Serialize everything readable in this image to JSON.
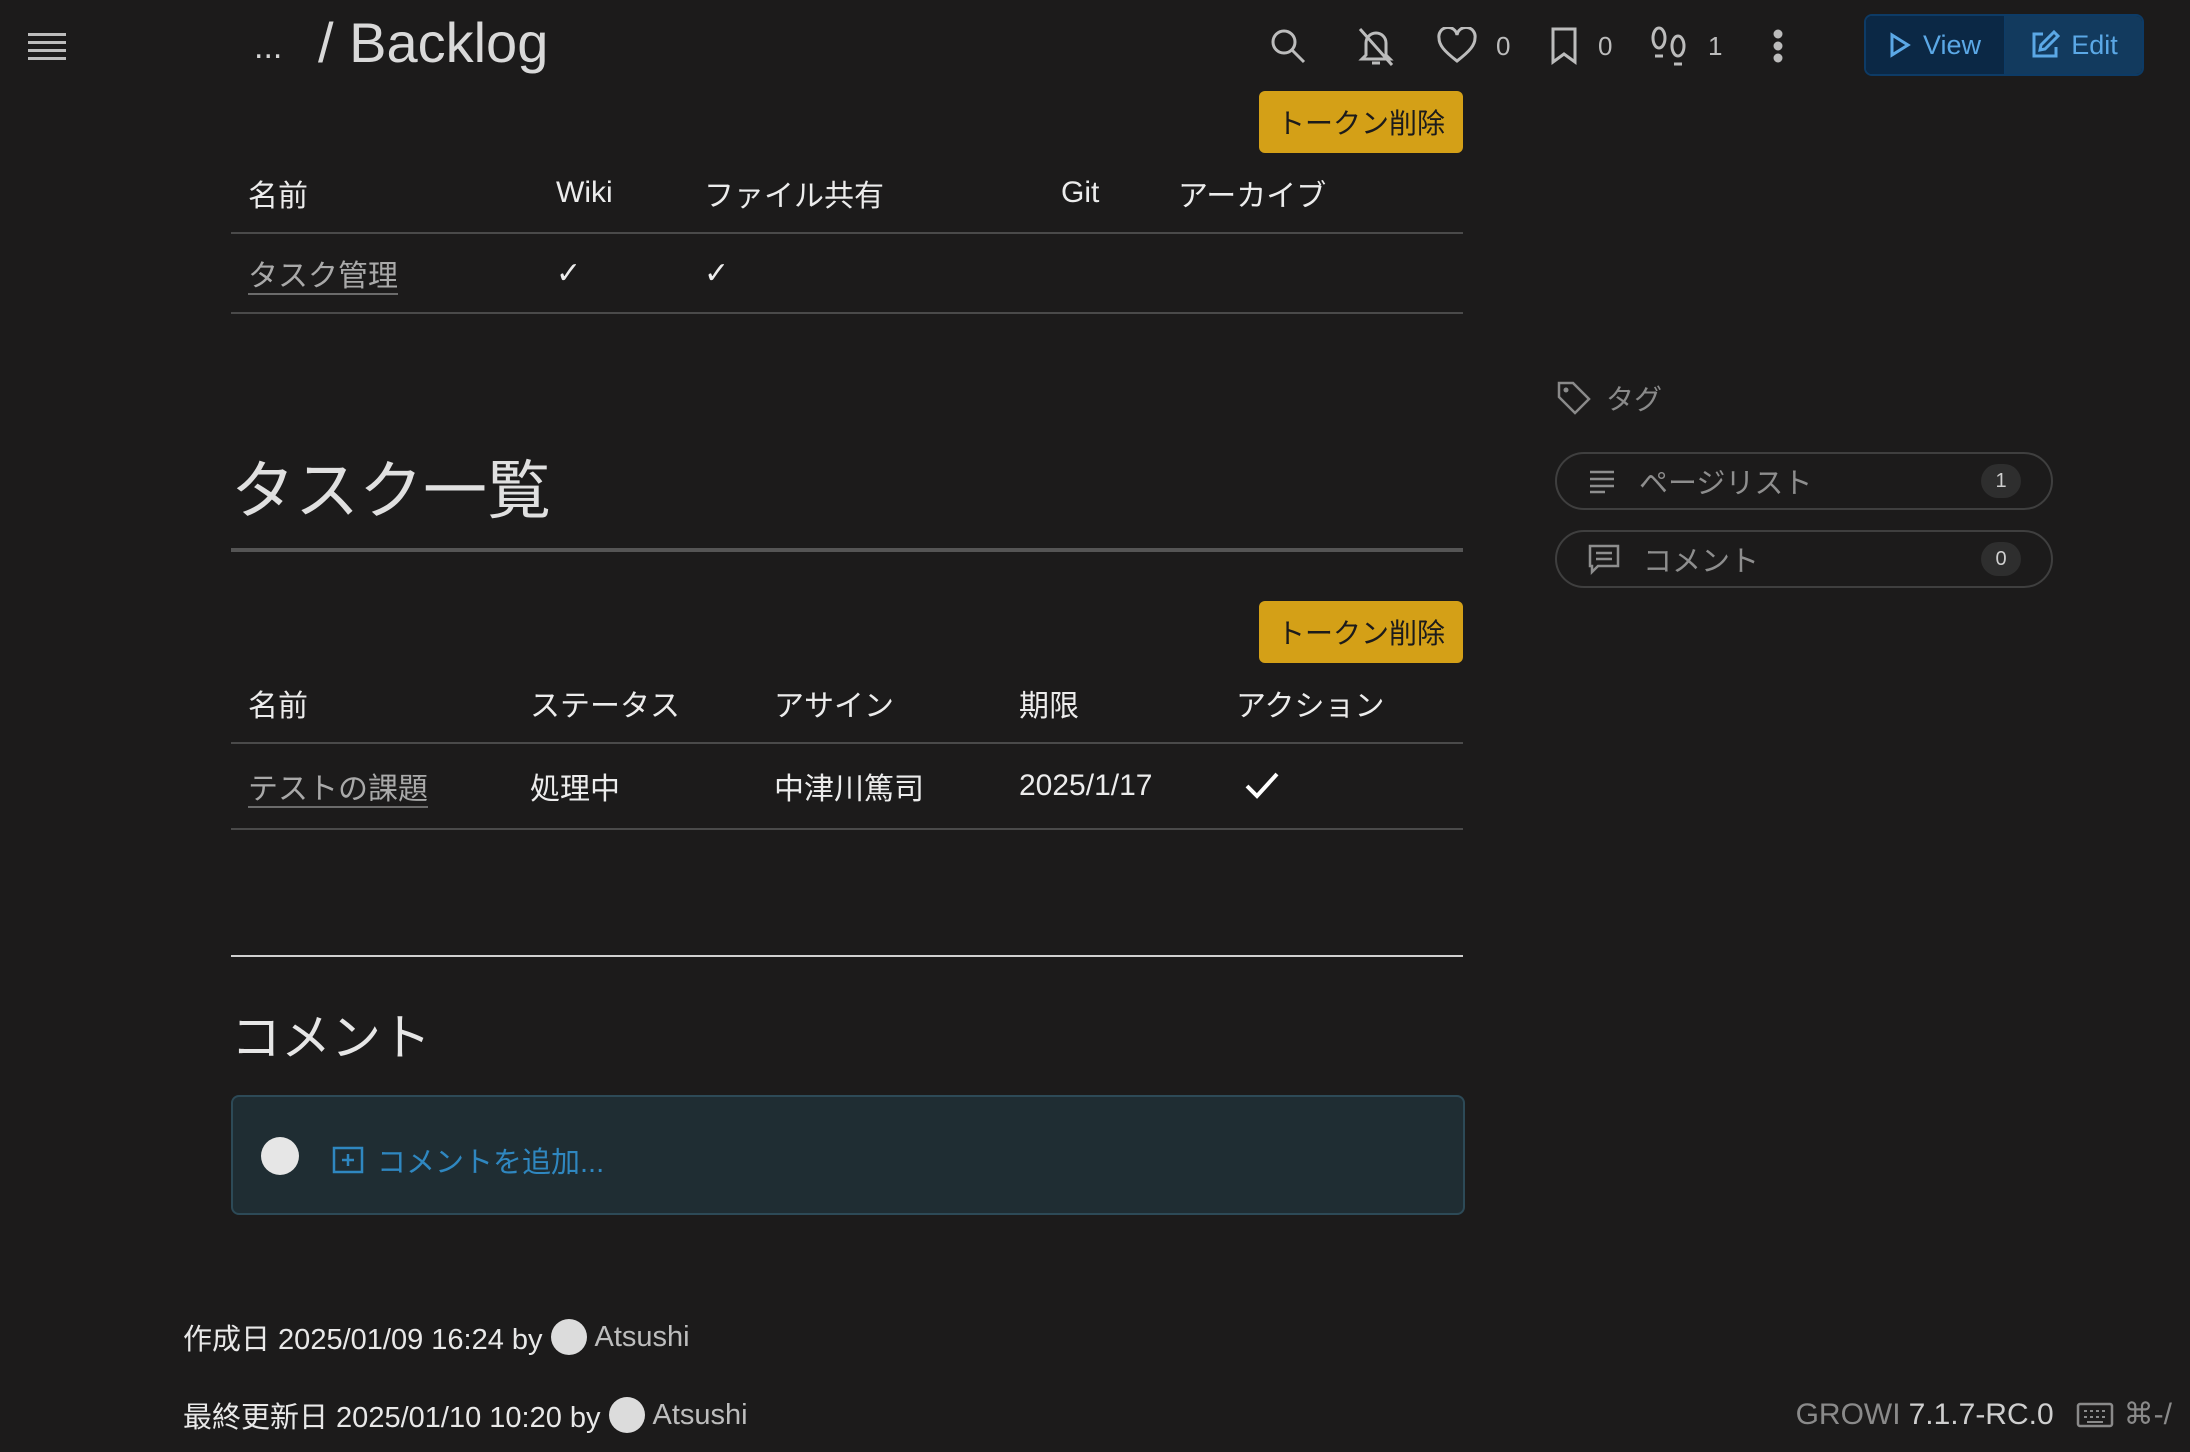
{
  "header": {
    "ellipsis": "...",
    "title": "/ Backlog",
    "like_count": "0",
    "bookmark_count": "0",
    "footprint_count": "1",
    "view_label": "View",
    "edit_label": "Edit"
  },
  "table1": {
    "token_btn": "トークン削除",
    "headers": [
      "名前",
      "Wiki",
      "ファイル共有",
      "Git",
      "アーカイブ"
    ],
    "rows": [
      {
        "name": "タスク管理",
        "wiki": "✓",
        "file": "✓",
        "git": "",
        "archive": ""
      }
    ]
  },
  "tasks": {
    "heading": "タスク一覧",
    "token_btn": "トークン削除",
    "headers": [
      "名前",
      "ステータス",
      "アサイン",
      "期限",
      "アクション"
    ],
    "rows": [
      {
        "name": "テストの課題",
        "status": "処理中",
        "assignee": "中津川篤司",
        "due": "2025/1/17"
      }
    ]
  },
  "comments": {
    "heading": "コメント",
    "add_label": "コメントを追加..."
  },
  "meta": {
    "created_label": "作成日 2025/01/09 16:24 by",
    "created_user": "Atsushi",
    "updated_label": "最終更新日 2025/01/10 10:20 by",
    "updated_user": "Atsushi"
  },
  "sidebar": {
    "tag_label": "タグ",
    "pagelist_label": "ページリスト",
    "pagelist_count": "1",
    "comment_label": "コメント",
    "comment_count": "0"
  },
  "footer": {
    "brand": "GROWI",
    "version": "7.1.7-RC.0",
    "shortcut": "⌘-/"
  },
  "colors": {
    "background": "#1c1b1b",
    "token_button": "#d4a017",
    "link_blue": "#2f87c0",
    "view_edit_blue": "#5ba8e6"
  }
}
